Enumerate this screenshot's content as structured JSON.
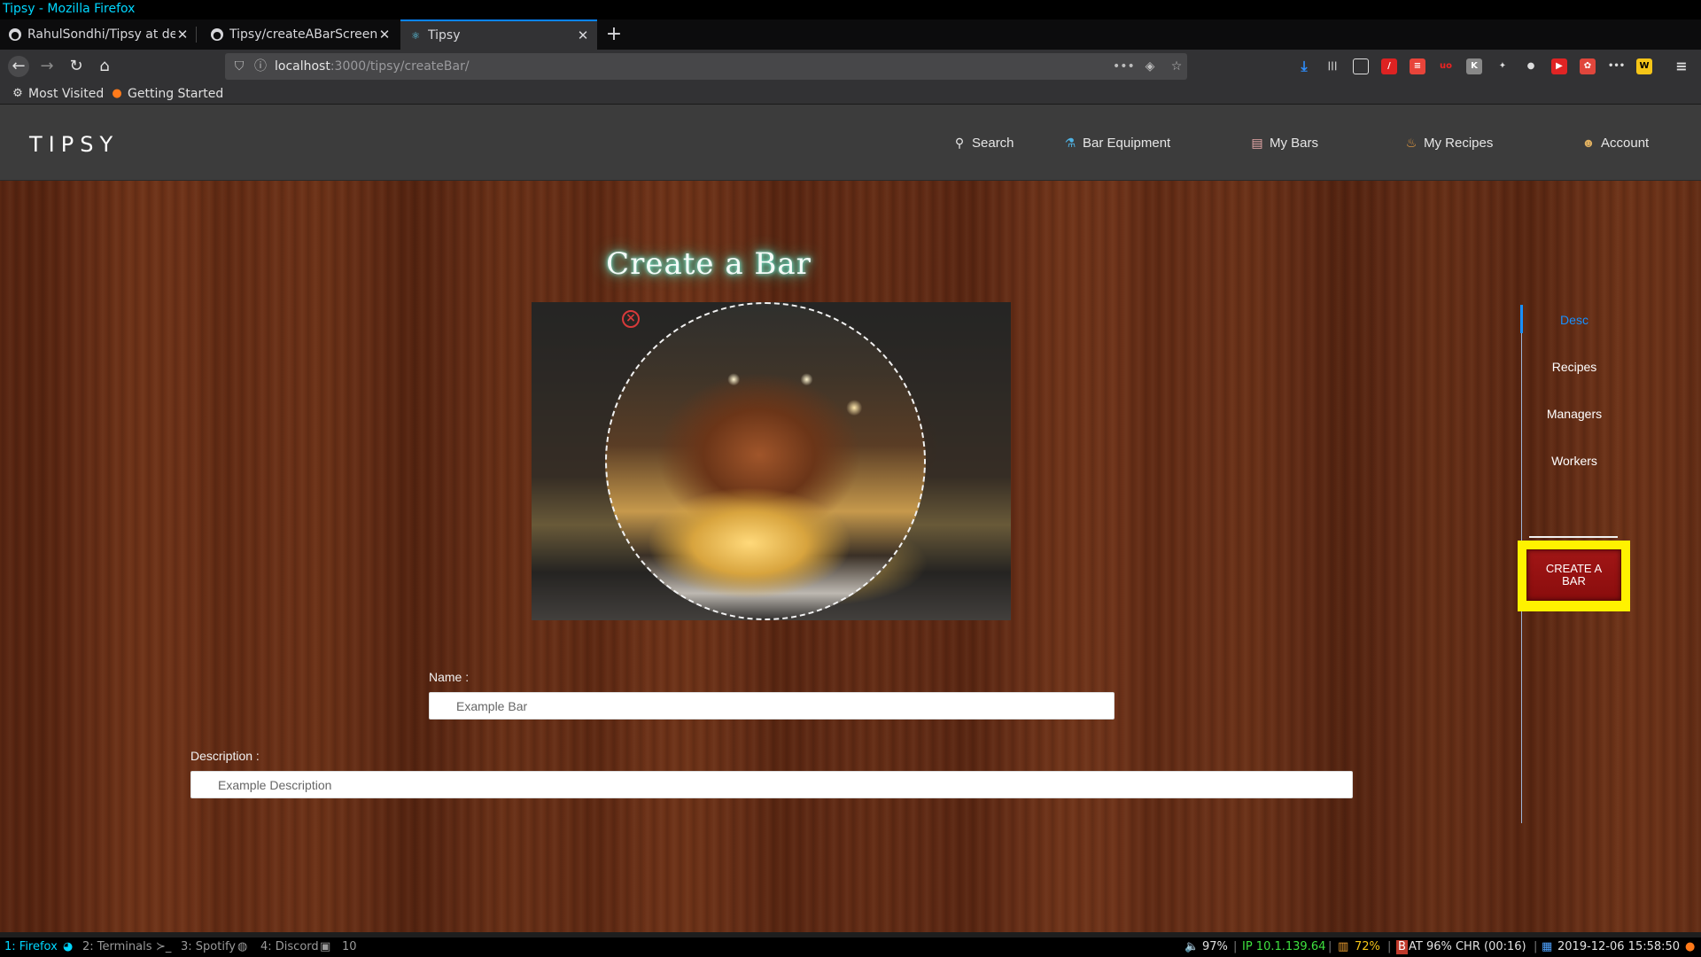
{
  "window": {
    "title": "Tipsy - Mozilla Firefox"
  },
  "browser": {
    "tabs": [
      {
        "label": "RahulSondhi/Tipsy at dev",
        "icon": "github-icon",
        "active": false
      },
      {
        "label": "Tipsy/createABarScreen",
        "icon": "github-icon",
        "active": false
      },
      {
        "label": "Tipsy",
        "icon": "react-icon",
        "active": true
      }
    ],
    "url_host": "localhost",
    "url_rest": ":3000/tipsy/createBar/",
    "bookmarks": [
      {
        "label": "Most Visited",
        "icon": "gear-icon"
      },
      {
        "label": "Getting Started",
        "icon": "firefox-icon"
      }
    ]
  },
  "site": {
    "brand": "TIPSY",
    "nav": [
      {
        "label": "Search",
        "icon": "search-icon"
      },
      {
        "label": "Bar Equipment",
        "icon": "equipment-icon"
      },
      {
        "label": "My Bars",
        "icon": "bar-icon"
      },
      {
        "label": "My Recipes",
        "icon": "bottle-icon"
      },
      {
        "label": "Account",
        "icon": "user-icon"
      }
    ]
  },
  "main": {
    "heading": "Create a Bar",
    "name_label": "Name :",
    "name_placeholder": "Example Bar",
    "description_label": "Description :",
    "description_placeholder": "Example Description"
  },
  "side_panel": {
    "links": [
      {
        "label": "Desc",
        "active": true
      },
      {
        "label": "Recipes",
        "active": false
      },
      {
        "label": "Managers",
        "active": false
      },
      {
        "label": "Workers",
        "active": false
      }
    ],
    "create_button": "CREATE A BAR",
    "highlight_color": "#fff200",
    "active_color": "#1890ff"
  },
  "statusbar": {
    "workspaces": [
      "1: Firefox",
      "2: Terminals",
      "3: Spotify",
      "4: Discord",
      "10"
    ],
    "volume": "97%",
    "ip": "IP 10.1.139.64",
    "cpu": "72%",
    "battery": "AT 96% CHR (00:16)",
    "datetime": "2019-12-06 15:58:50"
  }
}
